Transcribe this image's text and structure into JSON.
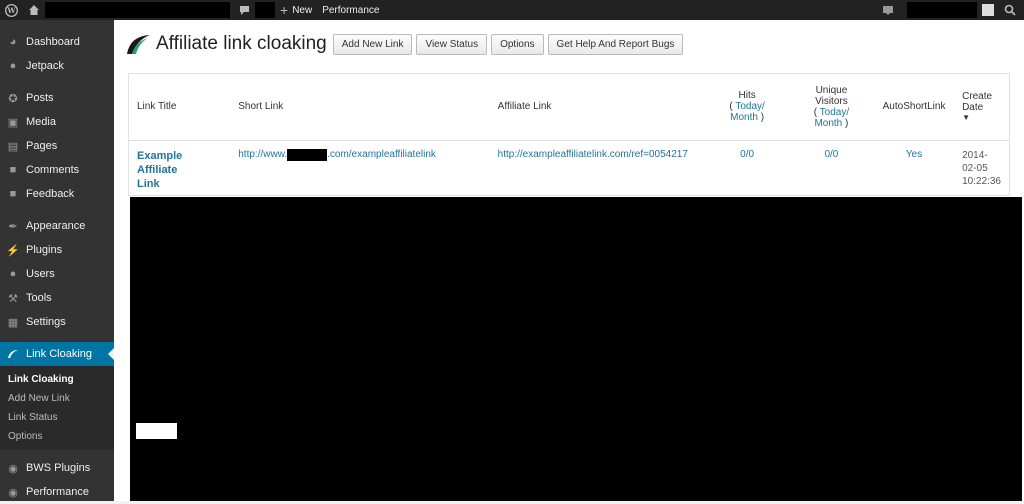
{
  "adminbar": {
    "new_label": "New",
    "performance_label": "Performance"
  },
  "sidebar": {
    "items_top": [
      {
        "label": "Dashboard",
        "icon": "dashboard-icon"
      },
      {
        "label": "Jetpack",
        "icon": "jetpack-icon"
      }
    ],
    "items_mid": [
      {
        "label": "Posts",
        "icon": "pin-icon"
      },
      {
        "label": "Media",
        "icon": "media-icon"
      },
      {
        "label": "Pages",
        "icon": "pages-icon"
      },
      {
        "label": "Comments",
        "icon": "comment-icon"
      },
      {
        "label": "Feedback",
        "icon": "feedback-icon"
      }
    ],
    "items_low": [
      {
        "label": "Appearance",
        "icon": "brush-icon"
      },
      {
        "label": "Plugins",
        "icon": "plug-icon"
      },
      {
        "label": "Users",
        "icon": "user-icon"
      },
      {
        "label": "Tools",
        "icon": "wrench-icon"
      },
      {
        "label": "Settings",
        "icon": "settings-icon"
      }
    ],
    "current": {
      "label": "Link Cloaking",
      "icon": "cloak-icon"
    },
    "submenu": [
      "Link Cloaking",
      "Add New Link",
      "Link Status",
      "Options"
    ],
    "items_bottom": [
      {
        "label": "BWS Plugins",
        "icon": "bws-icon"
      },
      {
        "label": "Performance",
        "icon": "performance-icon"
      }
    ]
  },
  "page": {
    "title": "Affiliate link cloaking",
    "buttons": [
      "Add New Link",
      "View Status",
      "Options",
      "Get Help And Report Bugs"
    ]
  },
  "table": {
    "headers": {
      "link_title": "Link Title",
      "short_link": "Short Link",
      "affiliate_link": "Affiliate Link",
      "hits": "Hits",
      "unique_visitors_1": "Unique",
      "unique_visitors_2": "Visitors",
      "today": "Today/",
      "month": "Month",
      "paren_open": "(",
      "paren_close": ")",
      "autoshortlink": "AutoShortLink",
      "create_1": "Create",
      "create_2": "Date"
    },
    "rows": [
      {
        "link_title_1": "Example Affiliate",
        "link_title_2": "Link",
        "short_prefix": "http://www.",
        "short_suffix": ".com/exampleaffiliatelink",
        "affiliate_link": "http://exampleaffiliatelink.com/ref=0054217",
        "hits": "0/0",
        "unique": "0/0",
        "auto": "Yes",
        "date_1": "2014-",
        "date_2": "02-05",
        "date_3": "10:22:36"
      }
    ]
  },
  "colors": {
    "admin_bar": "#222222",
    "sidebar": "#333333",
    "accent": "#0074a2",
    "link": "#21759b"
  }
}
